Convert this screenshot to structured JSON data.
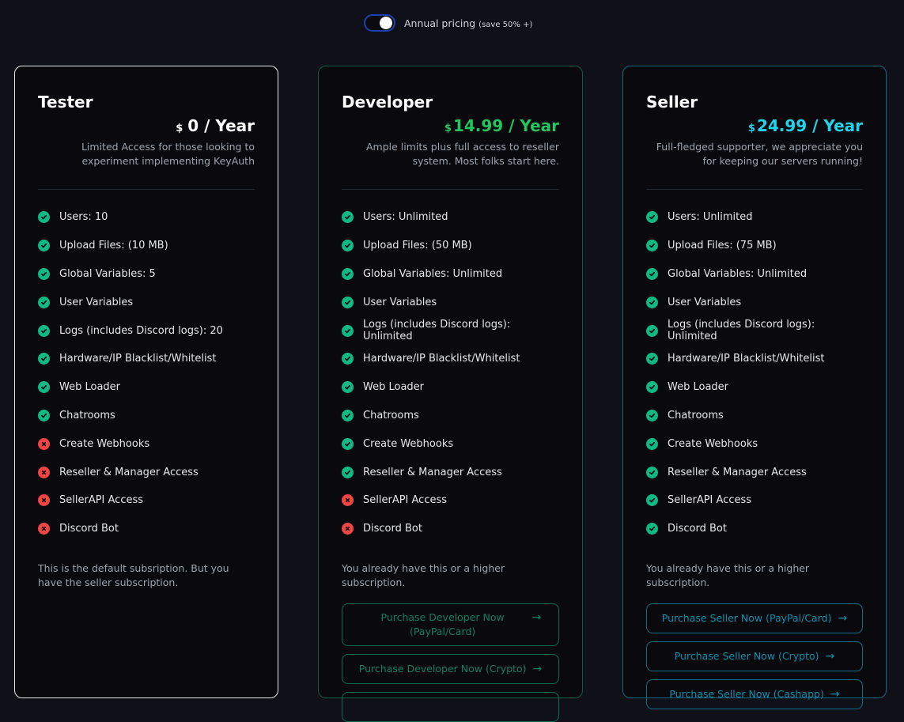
{
  "toggle": {
    "label": "Annual pricing",
    "note": "(save 50% +)",
    "enabled": true
  },
  "plans": [
    {
      "name": "Tester",
      "currency": "$",
      "price": "0 / Year",
      "description": "Limited Access for those looking to experiment implementing KeyAuth",
      "accent": "#ffffff",
      "features": [
        {
          "label": "Users: 10",
          "included": true
        },
        {
          "label": "Upload Files: (10 MB)",
          "included": true
        },
        {
          "label": "Global Variables: 5",
          "included": true
        },
        {
          "label": "User Variables",
          "included": true
        },
        {
          "label": "Logs (includes Discord logs): 20",
          "included": true
        },
        {
          "label": "Hardware/IP Blacklist/Whitelist",
          "included": true
        },
        {
          "label": "Web Loader",
          "included": true
        },
        {
          "label": "Chatrooms",
          "included": true
        },
        {
          "label": "Create Webhooks",
          "included": false
        },
        {
          "label": "Reseller & Manager Access",
          "included": false
        },
        {
          "label": "SellerAPI Access",
          "included": false
        },
        {
          "label": "Discord Bot",
          "included": false
        }
      ],
      "note": "This is the default subsription. But you have the seller subscription.",
      "buttons": []
    },
    {
      "name": "Developer",
      "currency": "$",
      "price": "14.99 / Year",
      "description": "Ample limits plus full access to reseller system. Most folks start here.",
      "accent": "#22c55e",
      "features": [
        {
          "label": "Users: Unlimited",
          "included": true
        },
        {
          "label": "Upload Files: (50 MB)",
          "included": true
        },
        {
          "label": "Global Variables: Unlimited",
          "included": true
        },
        {
          "label": "User Variables",
          "included": true
        },
        {
          "label": "Logs (includes Discord logs): Unlimited",
          "included": true
        },
        {
          "label": "Hardware/IP Blacklist/Whitelist",
          "included": true
        },
        {
          "label": "Web Loader",
          "included": true
        },
        {
          "label": "Chatrooms",
          "included": true
        },
        {
          "label": "Create Webhooks",
          "included": true
        },
        {
          "label": "Reseller & Manager Access",
          "included": true
        },
        {
          "label": "SellerAPI Access",
          "included": false
        },
        {
          "label": "Discord Bot",
          "included": false
        }
      ],
      "note": "You already have this or a higher subscription.",
      "buttons": [
        {
          "label": "Purchase Developer Now (PayPal/Card)",
          "icon": "arrow-right-icon"
        },
        {
          "label": "Purchase Developer Now (Crypto)",
          "icon": "arrow-right-icon"
        },
        {
          "label": "",
          "icon": "arrow-right-icon"
        }
      ]
    },
    {
      "name": "Seller",
      "currency": "$",
      "price": "24.99 / Year",
      "description": "Full-fledged supporter, we appreciate you for keeping our servers running!",
      "accent": "#22d3ee",
      "features": [
        {
          "label": "Users: Unlimited",
          "included": true
        },
        {
          "label": "Upload Files: (75 MB)",
          "included": true
        },
        {
          "label": "Global Variables: Unlimited",
          "included": true
        },
        {
          "label": "User Variables",
          "included": true
        },
        {
          "label": "Logs (includes Discord logs): Unlimited",
          "included": true
        },
        {
          "label": "Hardware/IP Blacklist/Whitelist",
          "included": true
        },
        {
          "label": "Web Loader",
          "included": true
        },
        {
          "label": "Chatrooms",
          "included": true
        },
        {
          "label": "Create Webhooks",
          "included": true
        },
        {
          "label": "Reseller & Manager Access",
          "included": true
        },
        {
          "label": "SellerAPI Access",
          "included": true
        },
        {
          "label": "Discord Bot",
          "included": true
        }
      ],
      "note": "You already have this or a higher subscription.",
      "buttons": [
        {
          "label": "Purchase Seller Now (PayPal/Card)",
          "icon": "arrow-right-icon"
        },
        {
          "label": "Purchase Seller Now (Crypto)",
          "icon": "arrow-right-icon"
        },
        {
          "label": "Purchase Seller Now (Cashapp)",
          "icon": "arrow-right-icon"
        }
      ]
    }
  ]
}
